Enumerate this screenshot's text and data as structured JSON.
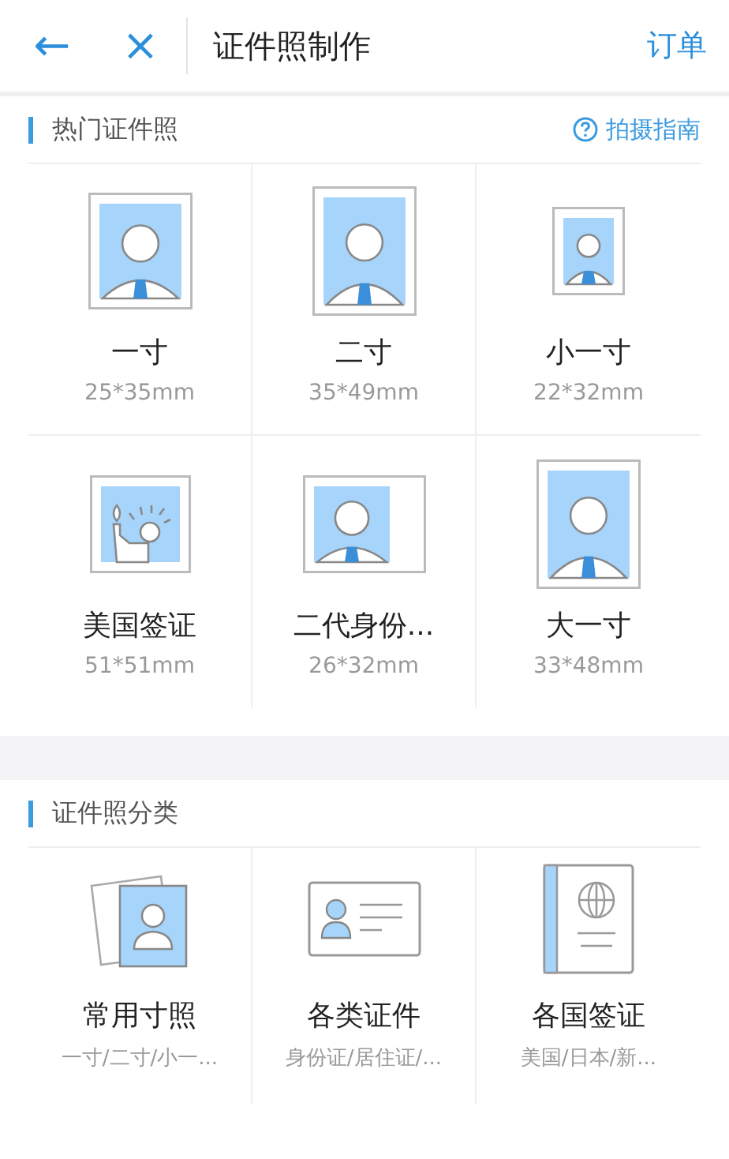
{
  "header": {
    "back": "←",
    "close": "×",
    "title": "证件照制作",
    "action": "订单"
  },
  "popular": {
    "title": "热门证件照",
    "guide": "拍摄指南",
    "items": [
      {
        "kind": "medium",
        "name": "一寸",
        "size": "25*35mm"
      },
      {
        "kind": "large",
        "name": "二寸",
        "size": "35*49mm"
      },
      {
        "kind": "small",
        "name": "小一寸",
        "size": "22*32mm"
      },
      {
        "kind": "statue",
        "name": "美国签证",
        "size": "51*51mm"
      },
      {
        "kind": "wide",
        "name": "二代身份...",
        "size": "26*32mm"
      },
      {
        "kind": "large",
        "name": "大一寸",
        "size": "33*48mm"
      }
    ]
  },
  "categories": {
    "title": "证件照分类",
    "items": [
      {
        "kind": "photos",
        "name": "常用寸照",
        "sub": "一寸/二寸/小一..."
      },
      {
        "kind": "card",
        "name": "各类证件",
        "sub": "身份证/居住证/..."
      },
      {
        "kind": "passport",
        "name": "各国签证",
        "sub": "美国/日本/新..."
      }
    ]
  }
}
